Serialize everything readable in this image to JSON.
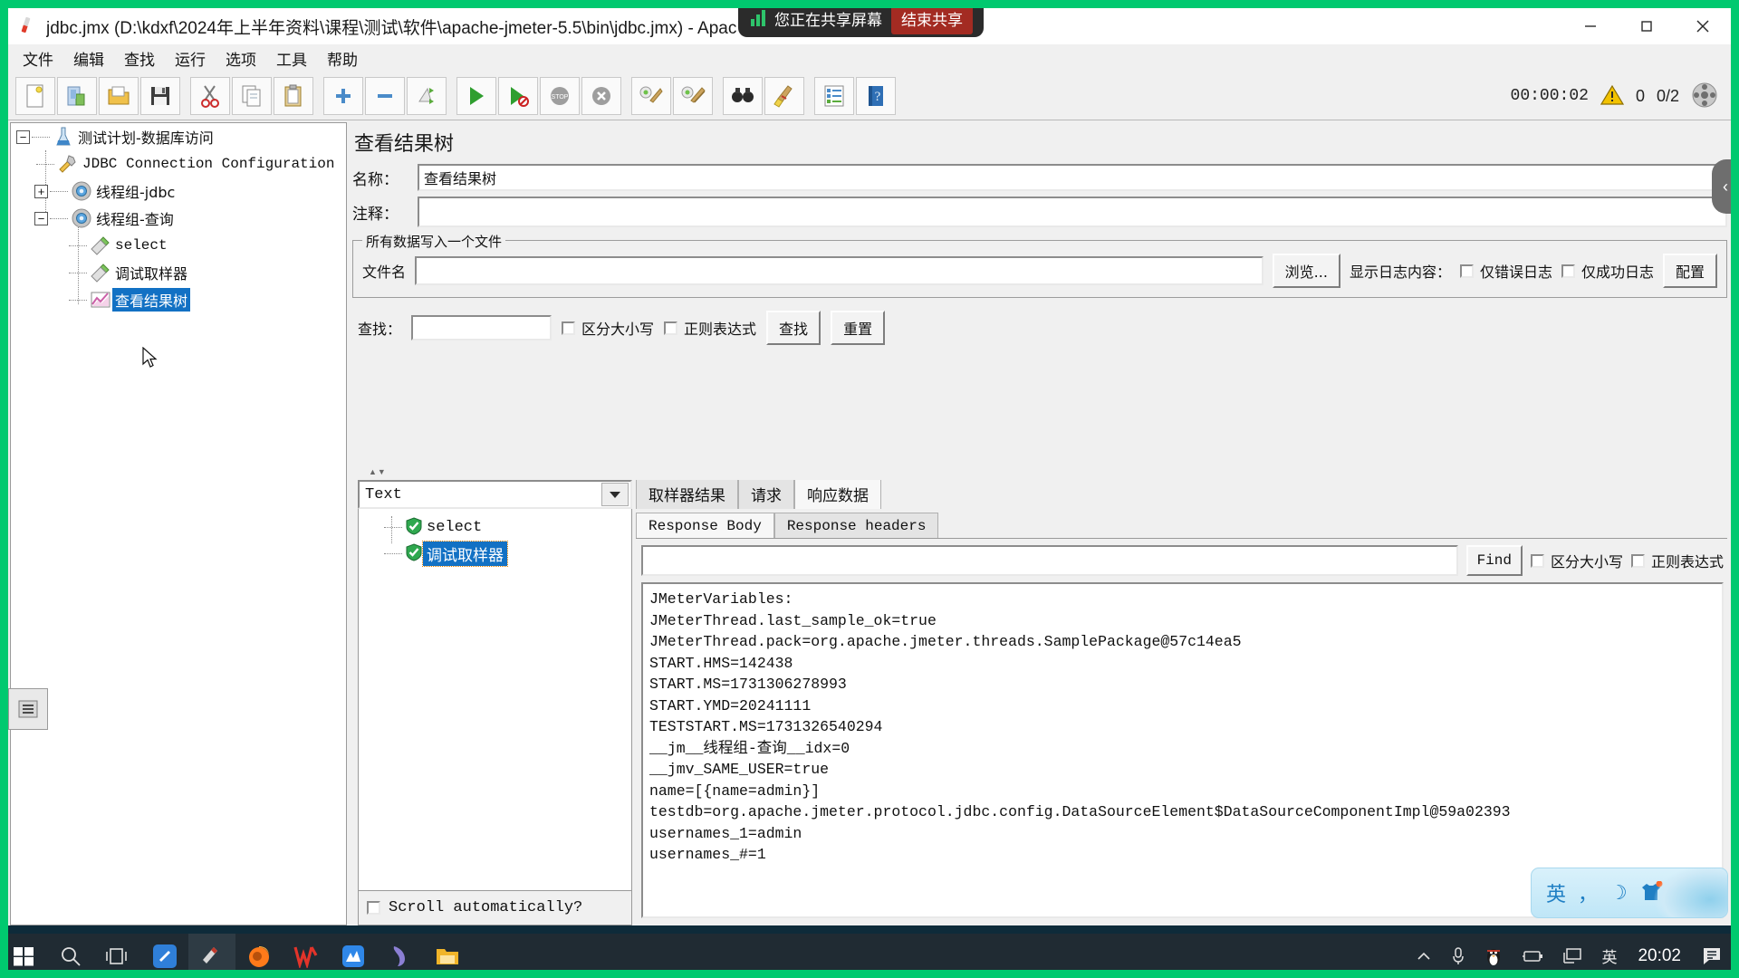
{
  "window": {
    "title": "jdbc.jmx (D:\\kdxf\\2024年上半年资料\\课程\\测试\\软件\\apache-jmeter-5.5\\bin\\jdbc.jmx) - Apac",
    "minimize_label": "—",
    "maximize_label": "▢",
    "close_label": "✕"
  },
  "share_overlay": {
    "text": "您正在共享屏幕",
    "stop_label": "结束共享",
    "accent": "#a32b22",
    "bars_color": "#2ec46b"
  },
  "menubar": {
    "items": [
      {
        "label": "文件"
      },
      {
        "label": "编辑"
      },
      {
        "label": "查找"
      },
      {
        "label": "运行"
      },
      {
        "label": "选项"
      },
      {
        "label": "工具"
      },
      {
        "label": "帮助"
      }
    ]
  },
  "toolbar": {
    "buttons": [
      {
        "name": "new-button",
        "icon": "new-document-icon"
      },
      {
        "name": "templates-button",
        "icon": "templates-icon"
      },
      {
        "name": "open-button",
        "icon": "open-folder-icon"
      },
      {
        "name": "save-button",
        "icon": "save-disk-icon"
      },
      {
        "name": "cut-button",
        "icon": "scissors-icon"
      },
      {
        "name": "copy-button",
        "icon": "copy-icon"
      },
      {
        "name": "paste-button",
        "icon": "clipboard-icon"
      },
      {
        "name": "expand-button",
        "icon": "plus-icon"
      },
      {
        "name": "collapse-button",
        "icon": "minus-icon"
      },
      {
        "name": "toggle-button",
        "icon": "toggle-icon"
      },
      {
        "name": "start-button",
        "icon": "play-icon"
      },
      {
        "name": "start-no-pause-button",
        "icon": "play-no-pause-icon"
      },
      {
        "name": "stop-button",
        "icon": "stop-icon"
      },
      {
        "name": "shutdown-button",
        "icon": "shutdown-icon"
      },
      {
        "name": "clear-button",
        "icon": "broom-gear-icon"
      },
      {
        "name": "clear-all-button",
        "icon": "broom-gear-all-icon"
      },
      {
        "name": "search-button",
        "icon": "binoculars-icon"
      },
      {
        "name": "reset-search-button",
        "icon": "broom-icon"
      },
      {
        "name": "function-helper-button",
        "icon": "list-icon"
      },
      {
        "name": "help-button",
        "icon": "help-book-icon"
      }
    ],
    "timer": "00:00:02",
    "warning_count": "0",
    "thread_count": "0/2"
  },
  "tree": {
    "nodes": [
      {
        "label": "测试计划-数据库访问",
        "icon": "test-plan-icon",
        "toggle": "−",
        "depth": 0,
        "selected": false,
        "cjk": true
      },
      {
        "label": "JDBC Connection Configuration",
        "icon": "config-wrench-icon",
        "toggle": "",
        "depth": 1,
        "selected": false,
        "cjk": false
      },
      {
        "label": "线程组-jdbc",
        "icon": "thread-group-icon",
        "toggle": "+",
        "depth": 1,
        "selected": false,
        "cjk": true
      },
      {
        "label": "线程组-查询",
        "icon": "thread-group-icon",
        "toggle": "−",
        "depth": 1,
        "selected": false,
        "cjk": true
      },
      {
        "label": "select",
        "icon": "sampler-icon",
        "toggle": "",
        "depth": 2,
        "selected": false,
        "cjk": false
      },
      {
        "label": "调试取样器",
        "icon": "sampler-icon",
        "toggle": "",
        "depth": 2,
        "selected": false,
        "cjk": true
      },
      {
        "label": "查看结果树",
        "icon": "view-results-tree-icon",
        "toggle": "",
        "depth": 2,
        "selected": true,
        "cjk": true
      }
    ]
  },
  "panel": {
    "title": "查看结果树",
    "name_label": "名称：",
    "name_value": "查看结果树",
    "comment_label": "注释：",
    "comment_value": "",
    "file_group": {
      "title": "所有数据写入一个文件",
      "filename_label": "文件名",
      "filename_value": "",
      "browse_label": "浏览...",
      "log_display_label": "显示日志内容：",
      "errors_only_label": "仅错误日志",
      "successes_only_label": "仅成功日志",
      "configure_label": "配置"
    },
    "search": {
      "label": "查找：",
      "value": "",
      "case_sensitive_label": "区分大小写",
      "regex_label": "正则表达式",
      "find_label": "查找",
      "reset_label": "重置"
    }
  },
  "results": {
    "renderer_value": "Text",
    "sampler_nodes": [
      {
        "label": "select",
        "status": "success",
        "selected": false,
        "cjk": false
      },
      {
        "label": "调试取样器",
        "status": "success",
        "selected": true,
        "cjk": true
      }
    ],
    "scroll_auto_label": "Scroll automatically?",
    "scroll_auto_checked": false,
    "tabs": [
      {
        "label": "取样器结果",
        "active": false
      },
      {
        "label": "请求",
        "active": false
      },
      {
        "label": "响应数据",
        "active": true
      }
    ],
    "subtabs": [
      {
        "label": "Response Body",
        "active": true
      },
      {
        "label": "Response headers",
        "active": false
      }
    ],
    "find": {
      "value": "",
      "find_label": "Find",
      "case_sensitive_label": "区分大小写",
      "regex_label": "正则表达式"
    },
    "response_body": [
      "JMeterVariables:",
      "JMeterThread.last_sample_ok=true",
      "JMeterThread.pack=org.apache.jmeter.threads.SamplePackage@57c14ea5",
      "START.HMS=142438",
      "START.MS=1731306278993",
      "START.YMD=20241111",
      "TESTSTART.MS=1731326540294",
      "__jm__线程组-查询__idx=0",
      "__jmv_SAME_USER=true",
      "name=[{name=admin}]",
      "testdb=org.apache.jmeter.protocol.jdbc.config.DataSourceElement$DataSourceComponentImpl@59a02393",
      "usernames_1=admin",
      "usernames_#=1"
    ]
  },
  "side_tab": {
    "collapse_label": "‹"
  },
  "ime": {
    "mode": "英",
    "punct": "，",
    "moon": "☽",
    "skin": "shirt-icon"
  },
  "taskbar": {
    "items": [
      {
        "name": "start-button",
        "icon": "windows-logo-icon"
      },
      {
        "name": "search-button",
        "icon": "search-icon"
      },
      {
        "name": "task-view-button",
        "icon": "task-view-icon"
      },
      {
        "name": "editor-app",
        "icon": "blue-note-icon"
      },
      {
        "name": "jmeter-app",
        "icon": "jmeter-feather-icon"
      },
      {
        "name": "firefox-app",
        "icon": "firefox-icon"
      },
      {
        "name": "wps-app",
        "icon": "wps-icon"
      },
      {
        "name": "xmind-app",
        "icon": "xmind-icon"
      },
      {
        "name": "navicat-app",
        "icon": "navicat-dolphin-icon"
      },
      {
        "name": "explorer-app",
        "icon": "folder-icon"
      }
    ],
    "tray": [
      {
        "name": "show-hidden-icons",
        "icon": "chevron-up-icon"
      },
      {
        "name": "microphone-icon",
        "icon": "microphone-icon"
      },
      {
        "name": "qq-icon",
        "icon": "penguin-icon"
      },
      {
        "name": "battery-icon",
        "icon": "battery-icon"
      },
      {
        "name": "network-icon",
        "icon": "monitor-icon"
      },
      {
        "name": "ime-indicator",
        "icon": "ime-chinese-icon",
        "label": "英"
      }
    ],
    "clock": "20:02",
    "notification_icon": "notification-icon"
  }
}
